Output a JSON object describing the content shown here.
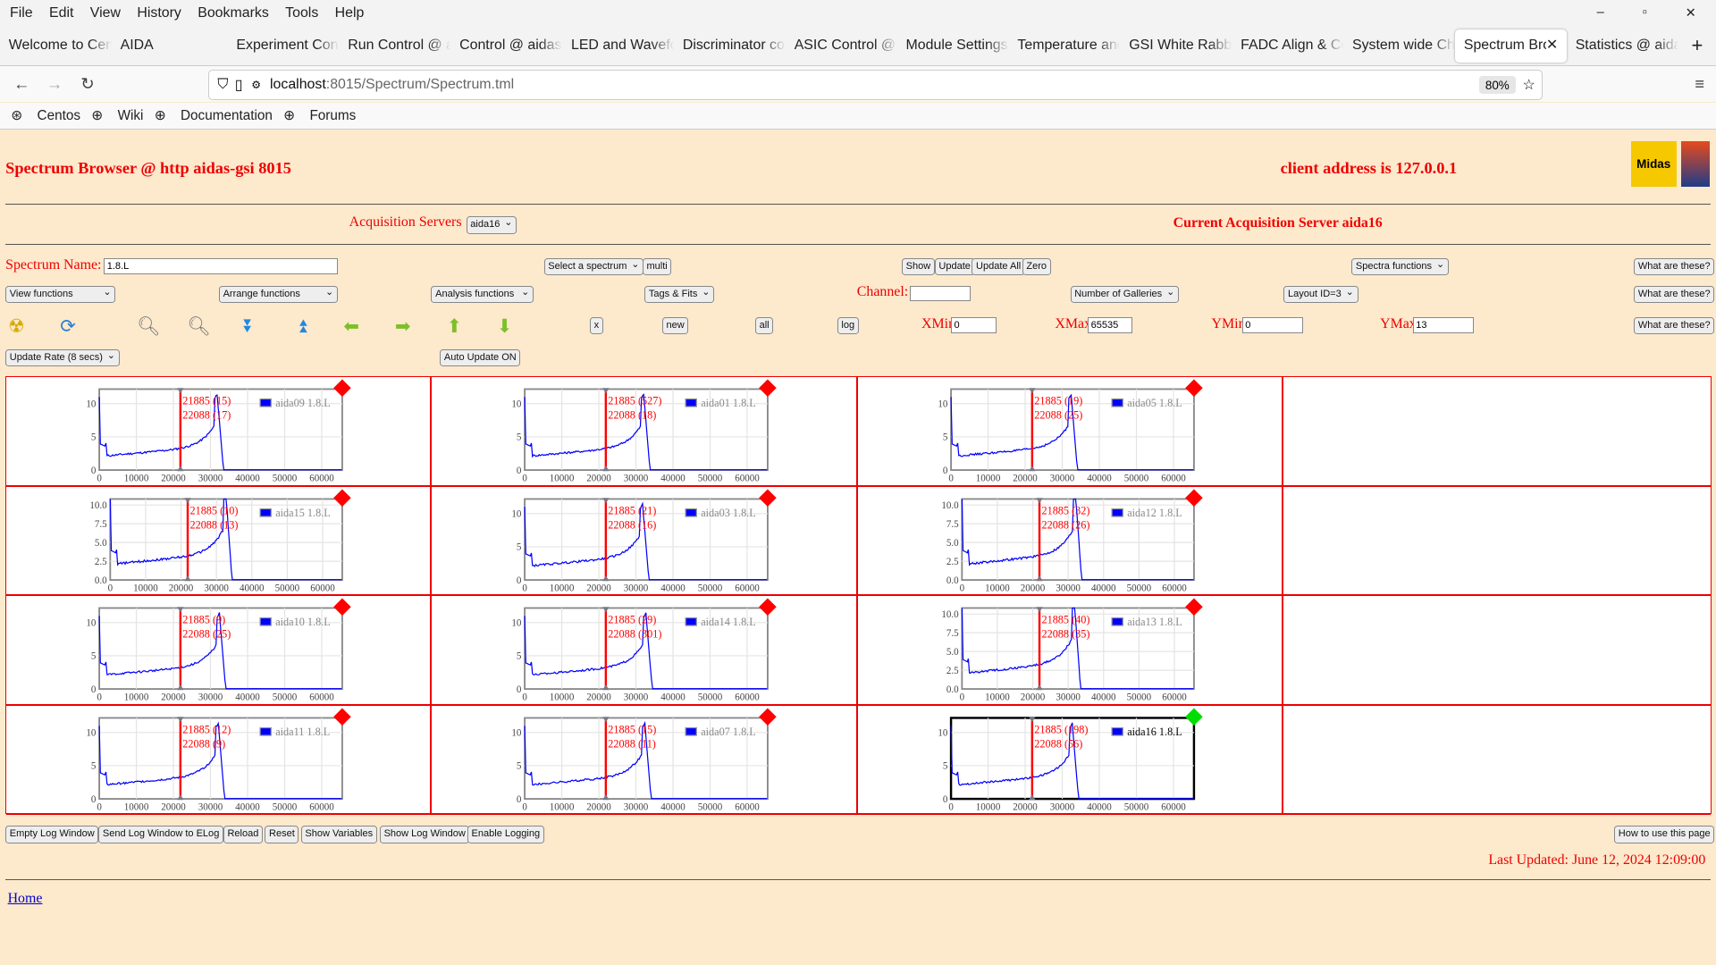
{
  "browser": {
    "menu": [
      "File",
      "Edit",
      "View",
      "History",
      "Bookmarks",
      "Tools",
      "Help"
    ],
    "tabs": [
      "Welcome to Centos",
      "AIDA",
      "Experiment Control",
      "Run Control @ aidas",
      "Control @ aidas",
      "LED and Waveform",
      "Discriminator control",
      "ASIC Control @",
      "Module Settings",
      "Temperature and",
      "GSI White Rabbit",
      "FADC Align & Control",
      "System wide Ch",
      "Spectrum Browser",
      "Statistics @ aidas"
    ],
    "active_tab": 13,
    "url_host": "localhost",
    "url_path": ":8015/Spectrum/Spectrum.tml",
    "zoom": "80%",
    "bookmarks": [
      "Centos",
      "Wiki",
      "Documentation",
      "Forums"
    ]
  },
  "header": {
    "title": "Spectrum Browser @ http aidas-gsi 8015",
    "client": "client address is 127.0.0.1",
    "logo_text": "Midas"
  },
  "servers": {
    "label": "Acquisition Servers",
    "selected": "aida16",
    "current": "Current Acquisition Server aida16"
  },
  "controls": {
    "spectrum_name_label": "Spectrum Name:",
    "spectrum_name": "1.8.L",
    "select_spectrum": "Select a spectrum",
    "multi": "multi",
    "show": "Show",
    "update": "Update",
    "update_all": "Update All",
    "zero": "Zero",
    "spectra_functions": "Spectra functions",
    "what": "What are these?",
    "view_functions": "View functions",
    "arrange_functions": "Arrange functions",
    "analysis_functions": "Analysis functions",
    "tags_fits": "Tags & Fits",
    "channel_label": "Channel:",
    "channel": "",
    "galleries": "Number of Galleries",
    "layout": "Layout ID=3",
    "x": "x",
    "new": "new",
    "all": "all",
    "log": "log",
    "xmin_label": "XMin",
    "xmin": "0",
    "xmax_label": "XMax",
    "xmax": "65535",
    "ymin_label": "YMin",
    "ymin": "0",
    "ymax_label": "YMax",
    "ymax": "13",
    "update_rate": "Update Rate (8 secs)",
    "auto_update": "Auto Update ON"
  },
  "icons": [
    "radiation-icon",
    "refresh-icon",
    "zoom-in-icon",
    "zoom-out-icon",
    "scroll-down-icon",
    "scroll-up-icon",
    "arrow-left-icon",
    "arrow-right-icon",
    "arrow-up-icon",
    "arrow-down-icon"
  ],
  "colors": {
    "accent": "#ee0000",
    "spectrum": "#0000ff",
    "ok": "#00dd00",
    "bad": "#ff0000",
    "background": "#fde9cc"
  },
  "x_ticks": [
    "0",
    "10000",
    "20000",
    "30000",
    "40000",
    "50000",
    "60000"
  ],
  "markers": [
    "21885",
    "22088"
  ],
  "galleries": [
    {
      "name": "aida09 1.8.L",
      "m1": "(15)",
      "m2": "(17)",
      "yt": [
        "10",
        "5",
        "0"
      ],
      "status": "bad"
    },
    {
      "name": "aida01 1.8.L",
      "m1": "(527)",
      "m2": "(18)",
      "yt": [
        "10",
        "5",
        "0"
      ],
      "status": "bad"
    },
    {
      "name": "aida05 1.8.L",
      "m1": "(19)",
      "m2": "(25)",
      "yt": [
        "10",
        "5",
        "0"
      ],
      "status": "bad"
    },
    {
      "name": "aida15 1.8.L",
      "m1": "(10)",
      "m2": "(13)",
      "yt": [
        "10.0",
        "7.5",
        "5.0",
        "2.5",
        "0.0"
      ],
      "status": "bad"
    },
    {
      "name": "aida03 1.8.L",
      "m1": "(21)",
      "m2": "(16)",
      "yt": [
        "10",
        "5",
        "0"
      ],
      "status": "bad"
    },
    {
      "name": "aida12 1.8.L",
      "m1": "(32)",
      "m2": "(26)",
      "yt": [
        "10.0",
        "7.5",
        "5.0",
        "2.5",
        "0.0"
      ],
      "status": "bad"
    },
    {
      "name": "aida10 1.8.L",
      "m1": "(9)",
      "m2": "(25)",
      "yt": [
        "10",
        "5",
        "0"
      ],
      "status": "bad"
    },
    {
      "name": "aida14 1.8.L",
      "m1": "(29)",
      "m2": "(301)",
      "yt": [
        "10",
        "5",
        "0"
      ],
      "status": "bad"
    },
    {
      "name": "aida13 1.8.L",
      "m1": "(40)",
      "m2": "(35)",
      "yt": [
        "10.0",
        "7.5",
        "5.0",
        "2.5",
        "0.0"
      ],
      "status": "bad"
    },
    {
      "name": "aida11 1.8.L",
      "m1": "(12)",
      "m2": "(9)",
      "yt": [
        "10",
        "5",
        "0"
      ],
      "status": "bad"
    },
    {
      "name": "aida07 1.8.L",
      "m1": "(15)",
      "m2": "(11)",
      "yt": [
        "10",
        "5",
        "0"
      ],
      "status": "bad"
    },
    {
      "name": "aida16 1.8.L",
      "m1": "(198)",
      "m2": "(56)",
      "yt": [
        "10",
        "5",
        "0"
      ],
      "status": "ok",
      "selected": true
    }
  ],
  "footer": {
    "buttons": [
      "Empty Log Window",
      "Send Log Window to ELog",
      "Reload",
      "Reset",
      "Show Variables",
      "Show Log Window",
      "Enable Logging"
    ],
    "how": "How to use this page",
    "updated": "Last Updated: June 12, 2024 12:09:00",
    "home": "Home"
  }
}
